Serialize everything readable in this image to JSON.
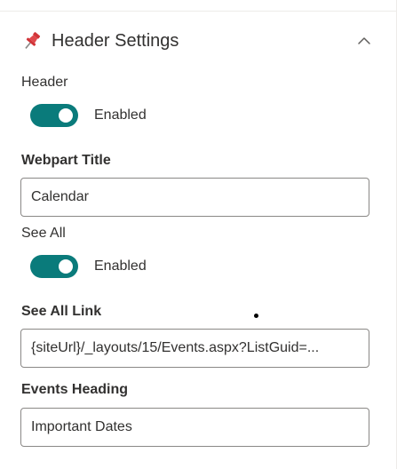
{
  "section": {
    "title": "Header Settings",
    "icon": "pushpin-icon",
    "collapse_icon": "chevron-up-icon"
  },
  "fields": {
    "header": {
      "label": "Header",
      "toggle_state": "Enabled",
      "on": true
    },
    "webpart_title": {
      "label": "Webpart Title",
      "value": "Calendar"
    },
    "see_all": {
      "label": "See All",
      "toggle_state": "Enabled",
      "on": true
    },
    "see_all_link": {
      "label": "See All Link",
      "value": "{siteUrl}/_layouts/15/Events.aspx?ListGuid=..."
    },
    "events_heading": {
      "label": "Events Heading",
      "value": "Important Dates"
    }
  },
  "colors": {
    "toggle_on": "#0a7b7b",
    "pin_red": "#d13438",
    "text": "#323130",
    "input_border": "#8a8886"
  }
}
